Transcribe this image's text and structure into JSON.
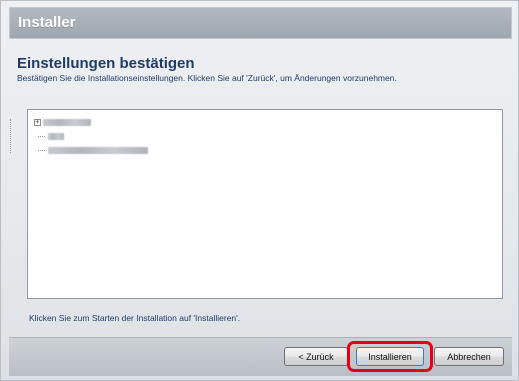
{
  "window": {
    "title": "Installer"
  },
  "header": {
    "title": "Einstellungen bestätigen",
    "subtitle": "Bestätigen Sie die Installationseinstellungen. Klicken Sie auf 'Zurück', um Änderungen vorzunehmen."
  },
  "tree": {
    "expander_symbol": "+"
  },
  "instruction": "Klicken Sie zum Starten der Installation auf 'Installieren'.",
  "buttons": {
    "back_label": "< Zurück",
    "install_label": "Installieren",
    "cancel_label": "Abbrechen"
  },
  "colors": {
    "highlight": "#e2001a",
    "heading": "#1f3d6b",
    "titlebar": "#a8b0b8"
  }
}
